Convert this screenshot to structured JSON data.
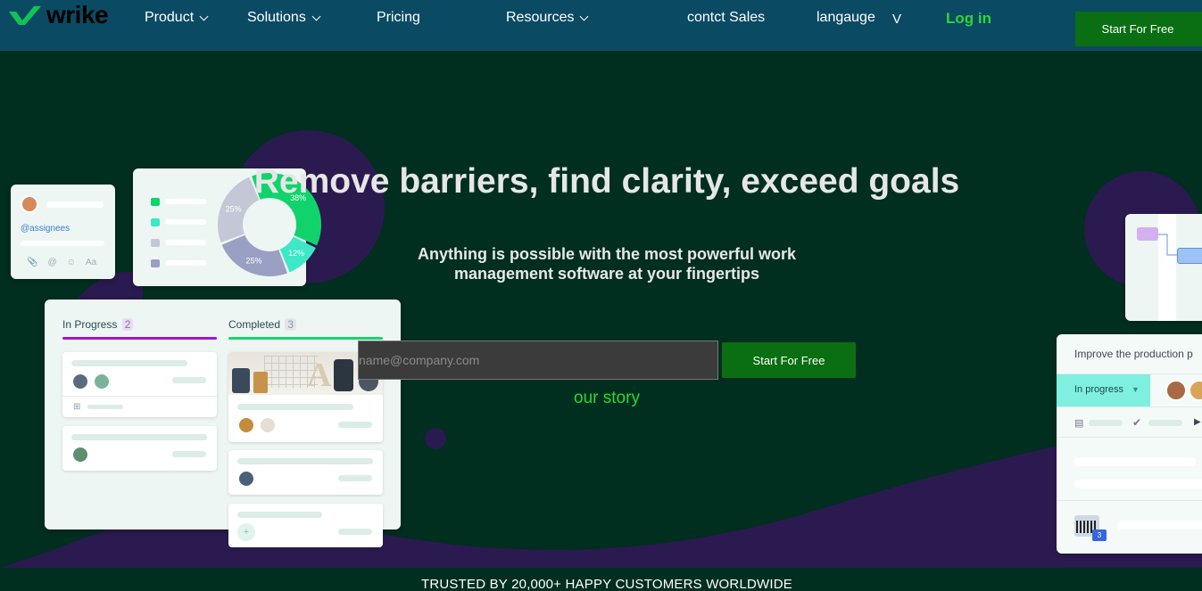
{
  "nav": {
    "brand": "wrike",
    "product": "Product",
    "solutions": "Solutions",
    "pricing": "Pricing",
    "resources": "Resources",
    "contact": "contct Sales",
    "language": "langauge",
    "language_caret": "V",
    "login": "Log in",
    "cta": "Start For Free"
  },
  "hero": {
    "headline": "Remove barriers, find clarity, exceed goals",
    "subheadline_1": "Anything is possible with the most powerful work",
    "subheadline_2": "management software at your fingertips",
    "email_placeholder": "name@company.com",
    "cta": "Start For Free",
    "story_link": "our story"
  },
  "illustration": {
    "assignees": "@assignees",
    "attach_icons": [
      "paperclip-icon",
      "at-icon",
      "smile-icon"
    ],
    "text_format": "Aa",
    "donut": {
      "segments": [
        {
          "label": "38%",
          "value": 38,
          "color": "#10d46b"
        },
        {
          "label": "12%",
          "value": 12,
          "color": "#3de8c7"
        },
        {
          "label": "25%",
          "value": 25,
          "color": "#9aa0c3"
        },
        {
          "label": "25%",
          "value": 25,
          "color": "#c4c8d6"
        }
      ]
    },
    "board": {
      "in_progress": "In Progress",
      "in_progress_count": "2",
      "completed": "Completed",
      "completed_count": "3",
      "in_progress_color": "#a212e0",
      "completed_color": "#16d46b"
    },
    "right_card": {
      "title": "Improve the production p",
      "status": "In progress",
      "badge": "3"
    }
  },
  "footer": {
    "trusted": "TRUSTED BY 20,000+ HAPPY CUSTOMERS WORLDWIDE"
  },
  "colors": {
    "nav_bg": "#0b4a63",
    "hero_bg": "#002e1f",
    "accent_green": "#0a6e12",
    "link_green": "#2bd63a",
    "purple": "#2b1a4f"
  }
}
